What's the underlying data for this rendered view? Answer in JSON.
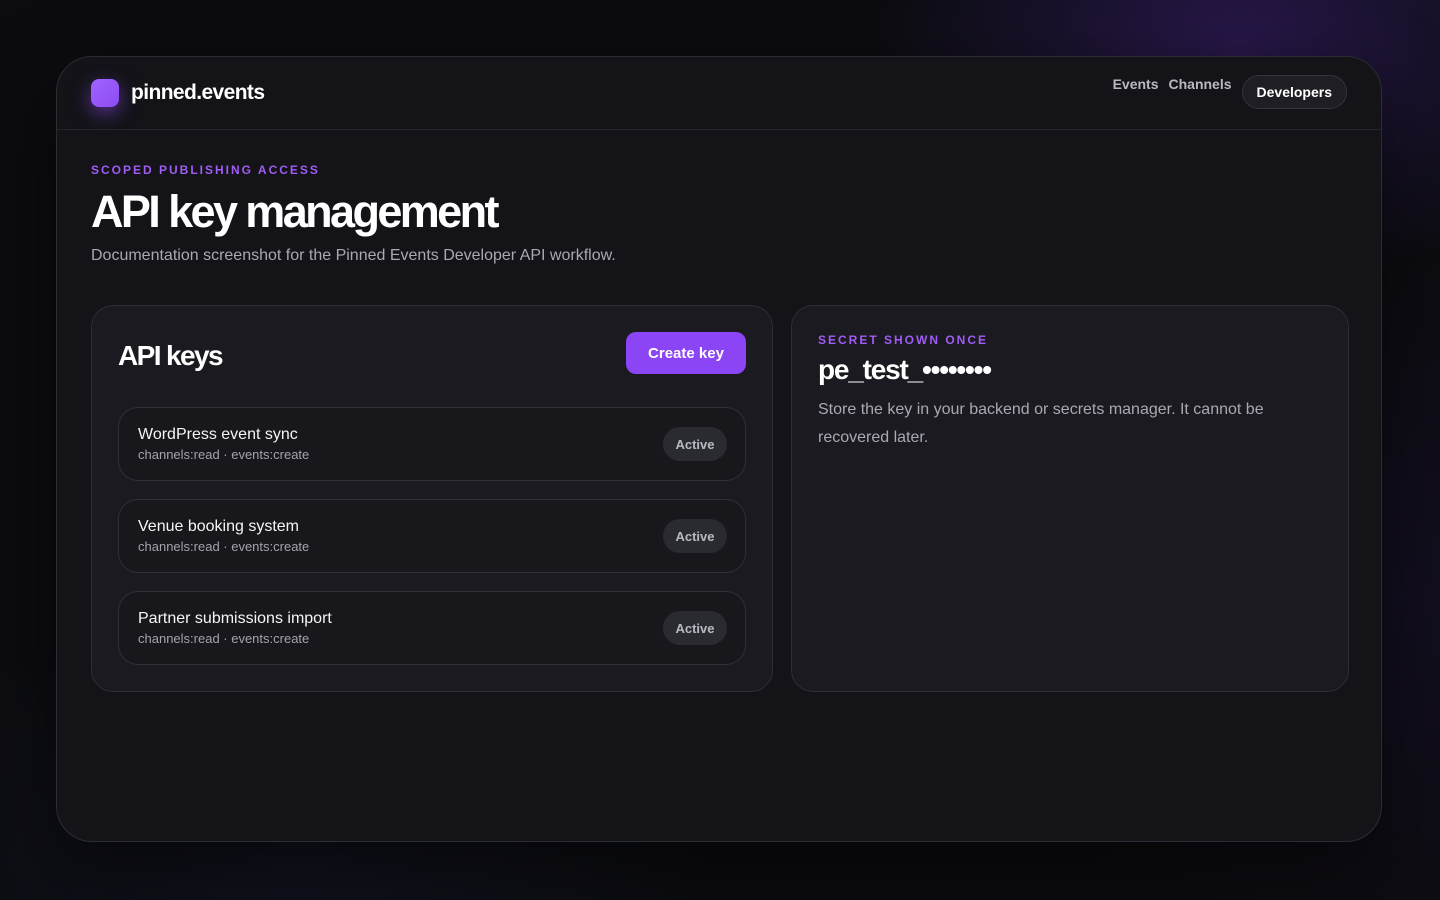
{
  "brand": {
    "name": "pinned.events",
    "logo_icon": "rounded-square-logo-icon",
    "accent": "#8b45f5"
  },
  "nav": {
    "items": [
      {
        "label": "Events"
      },
      {
        "label": "Channels"
      },
      {
        "label": "Developers",
        "active": true
      }
    ]
  },
  "hero": {
    "eyebrow": "SCOPED PUBLISHING ACCESS",
    "title": "API key management",
    "description": "Documentation screenshot for the Pinned Events Developer API workflow."
  },
  "keys_panel": {
    "title": "API keys",
    "create_label": "Create key",
    "keys": [
      {
        "name": "WordPress event sync",
        "scopes": "channels:read · events:create",
        "status": "Active"
      },
      {
        "name": "Venue booking system",
        "scopes": "channels:read · events:create",
        "status": "Active"
      },
      {
        "name": "Partner submissions import",
        "scopes": "channels:read · events:create",
        "status": "Active"
      }
    ]
  },
  "secret_panel": {
    "eyebrow": "SECRET SHOWN ONCE",
    "value": "pe_test_••••••••",
    "note": "Store the key in your backend or secrets manager. It cannot be recovered later."
  }
}
